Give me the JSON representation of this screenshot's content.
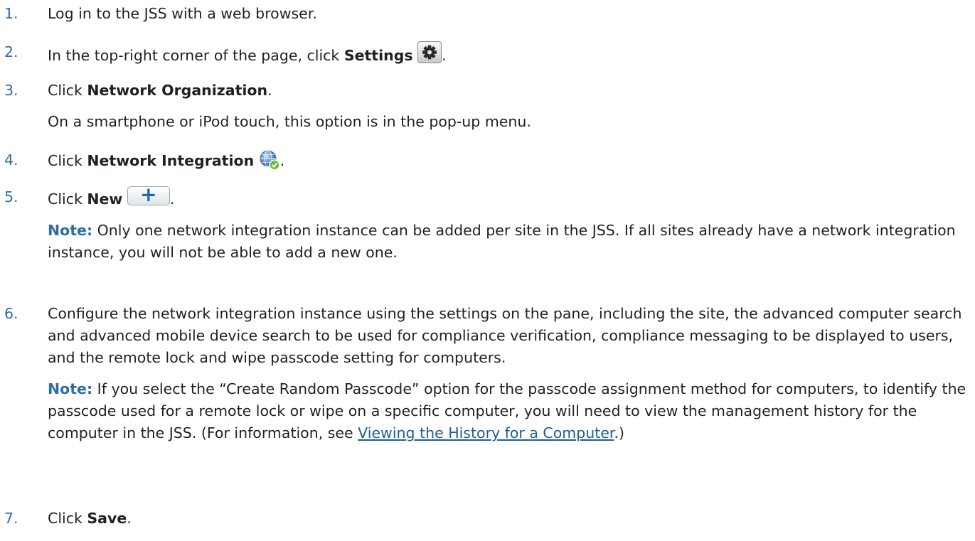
{
  "steps": [
    {
      "num": "1.",
      "text": "Log in to the JSS with a web browser."
    },
    {
      "num": "2.",
      "pre": "In the top-right corner of the page, click ",
      "bold": "Settings",
      "post": ".",
      "icon": "gear-icon"
    },
    {
      "num": "3.",
      "pre": "Click ",
      "bold": "Network Organization",
      "post": ".",
      "sub": "On a smartphone or iPod touch, this option is in the pop-up menu."
    },
    {
      "num": "4.",
      "pre": "Click ",
      "bold": "Network Integration",
      "post": ".",
      "icon": "globe-check-icon"
    },
    {
      "num": "5.",
      "pre": "Click ",
      "bold": "New",
      "post": ".",
      "icon": "plus-button-icon",
      "note_label": "Note:",
      "note_text": " Only one network integration instance can be added per site in the JSS. If all sites already have a network integration instance, you will not be able to add a new one."
    },
    {
      "num": "6.",
      "text": "Configure the network integration instance using the settings on the pane, including the site, the advanced computer search and advanced mobile device search to be used for compliance verification, compliance messaging to be displayed to users, and the remote lock and wipe passcode setting for computers.",
      "note_label": "Note:",
      "note_text": " If you select the “Create Random Passcode” option for the passcode assignment method for computers, to identify the passcode used for a remote lock or wipe on a specific computer, you will need to view the management history for the computer in the JSS. (For information, see ",
      "link": "Viewing the History for a Computer",
      "note_end": ".)"
    },
    {
      "num": "7.",
      "pre": "Click ",
      "bold": "Save",
      "post": "."
    }
  ],
  "colors": {
    "number": "#2f6ea4",
    "note_label": "#2f6ea4",
    "link": "#1f5d96",
    "text": "#231f20"
  }
}
